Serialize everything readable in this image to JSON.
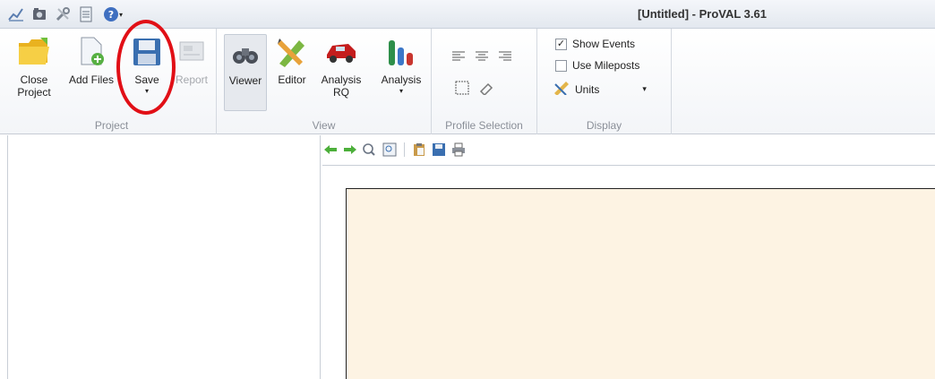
{
  "window": {
    "title": "[Untitled] - ProVAL 3.61"
  },
  "quick_access": {
    "icons": [
      "chart-icon",
      "camera-icon",
      "tools-icon",
      "document-icon",
      "help-icon"
    ],
    "help_caret": "▾"
  },
  "ribbon": {
    "project": {
      "label": "Project",
      "close_project": "Close\nProject",
      "add_files": "Add Files",
      "save": "Save",
      "save_caret": "▾",
      "report": "Report"
    },
    "view": {
      "label": "View",
      "viewer": "Viewer",
      "editor": "Editor",
      "analysis_rq": "Analysis\nRQ",
      "analysis": "Analysis",
      "analysis_caret": "▾"
    },
    "profile_selection": {
      "label": "Profile Selection"
    },
    "display": {
      "label": "Display",
      "show_events": "Show Events",
      "show_events_checked": true,
      "use_mileposts": "Use Mileposts",
      "use_mileposts_checked": false,
      "units": "Units",
      "units_caret": "▾"
    }
  },
  "colors": {
    "highlight": "#e10f16",
    "plot_background": "#fdf3e3",
    "folder": "#f2c531",
    "save_blue": "#3a6fb0"
  }
}
